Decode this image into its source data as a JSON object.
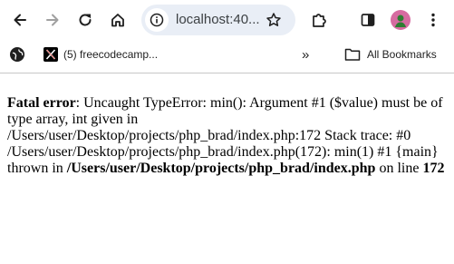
{
  "browser": {
    "url_display": "localhost:40...",
    "icons": {
      "back": "arrow-left-icon",
      "forward": "arrow-right-icon",
      "reload": "reload-icon",
      "home": "home-icon",
      "site_info": "site-info-icon",
      "star": "star-icon",
      "extensions": "puzzle-piece-icon",
      "side_panel": "side-panel-icon",
      "profile": "profile-avatar"
    }
  },
  "bookmarks_bar": {
    "items": [
      {
        "icon": "globe-icon",
        "label": ""
      },
      {
        "icon": "x-logo-icon",
        "label": "(5) freecodecamp..."
      }
    ],
    "overflow_label": "»",
    "all_bookmarks_label": "All Bookmarks"
  },
  "error": {
    "heading": "Fatal error",
    "message": ": Uncaught TypeError: min(): Argument #1 ($value) must be of type array, int given in /Users/user/Desktop/projects/php_brad/index.php:172 Stack trace: #0 /Users/user/Desktop/projects/php_brad/index.php(172): min(1) #1 {main} thrown in ",
    "file": "/Users/user/Desktop/projects/php_brad/index.php",
    "on_line_text": " on line ",
    "line": "172"
  },
  "colors": {
    "omnibox_bg": "#e9eef6",
    "icon": "#1f1f1f",
    "icon_disabled": "#a0a0a0",
    "profile_bg": "#d66ba0",
    "profile_fg": "#2e7d32",
    "divider": "#c7c7c7"
  }
}
